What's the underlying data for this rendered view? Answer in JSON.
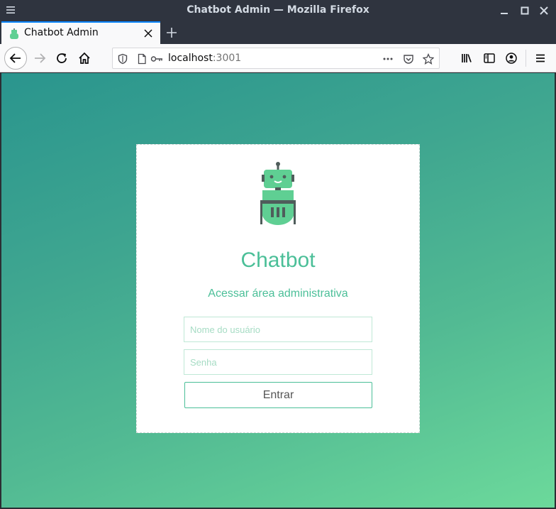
{
  "window": {
    "title": "Chatbot Admin — Mozilla Firefox"
  },
  "tab": {
    "title": "Chatbot Admin"
  },
  "urlbar": {
    "host": "localhost",
    "port": ":3001"
  },
  "card": {
    "title": "Chatbot",
    "subtitle": "Acessar área administrativa",
    "username_placeholder": "Nome do usuário",
    "password_placeholder": "Senha",
    "submit_label": "Entrar"
  },
  "colors": {
    "accent": "#4bbf98",
    "robot_green": "#5fcf93",
    "robot_dark": "#4f5d5b",
    "tab_highlight": "#0a84ff"
  }
}
